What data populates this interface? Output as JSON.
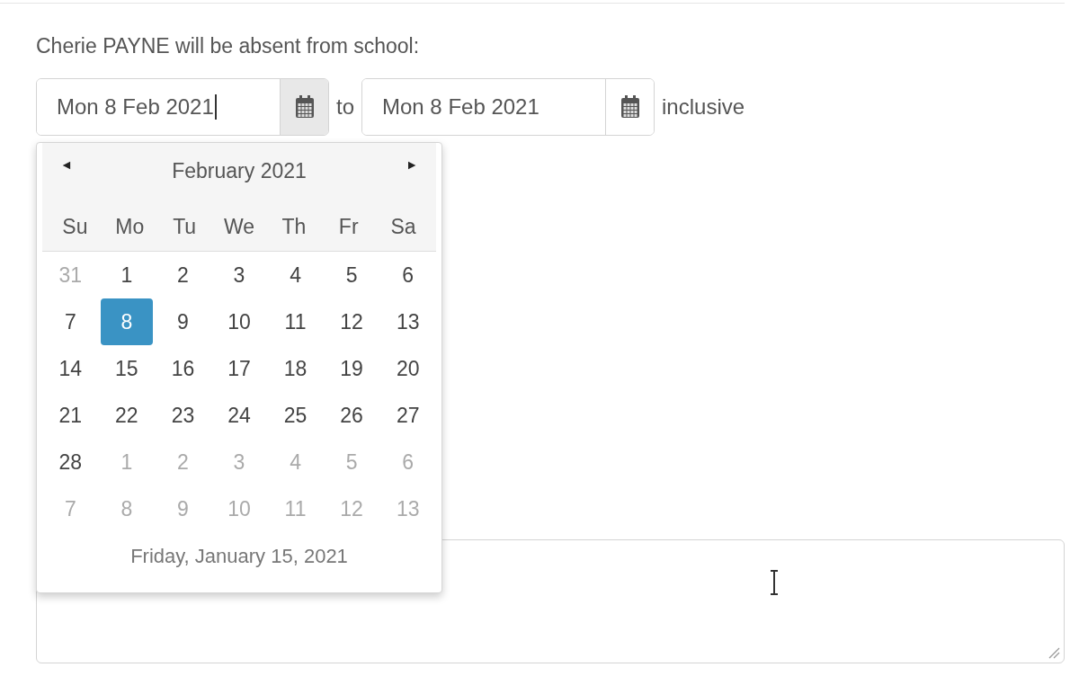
{
  "intro": "Cherie PAYNE will be absent from school:",
  "date_from": {
    "value": "Mon 8 Feb 2021",
    "focused": true,
    "picker_open": true
  },
  "separator": "to",
  "date_to": {
    "value": "Mon 8 Feb 2021",
    "focused": false,
    "picker_open": false
  },
  "suffix": "inclusive",
  "calendar": {
    "prev": "◄",
    "title": "February 2021",
    "next": "►",
    "weekdays": [
      "Su",
      "Mo",
      "Tu",
      "We",
      "Th",
      "Fr",
      "Sa"
    ],
    "days": [
      {
        "label": "31",
        "muted": true,
        "selected": false
      },
      {
        "label": "1",
        "muted": false,
        "selected": false
      },
      {
        "label": "2",
        "muted": false,
        "selected": false
      },
      {
        "label": "3",
        "muted": false,
        "selected": false
      },
      {
        "label": "4",
        "muted": false,
        "selected": false
      },
      {
        "label": "5",
        "muted": false,
        "selected": false
      },
      {
        "label": "6",
        "muted": false,
        "selected": false
      },
      {
        "label": "7",
        "muted": false,
        "selected": false
      },
      {
        "label": "8",
        "muted": false,
        "selected": true
      },
      {
        "label": "9",
        "muted": false,
        "selected": false
      },
      {
        "label": "10",
        "muted": false,
        "selected": false
      },
      {
        "label": "11",
        "muted": false,
        "selected": false
      },
      {
        "label": "12",
        "muted": false,
        "selected": false
      },
      {
        "label": "13",
        "muted": false,
        "selected": false
      },
      {
        "label": "14",
        "muted": false,
        "selected": false
      },
      {
        "label": "15",
        "muted": false,
        "selected": false
      },
      {
        "label": "16",
        "muted": false,
        "selected": false
      },
      {
        "label": "17",
        "muted": false,
        "selected": false
      },
      {
        "label": "18",
        "muted": false,
        "selected": false
      },
      {
        "label": "19",
        "muted": false,
        "selected": false
      },
      {
        "label": "20",
        "muted": false,
        "selected": false
      },
      {
        "label": "21",
        "muted": false,
        "selected": false
      },
      {
        "label": "22",
        "muted": false,
        "selected": false
      },
      {
        "label": "23",
        "muted": false,
        "selected": false
      },
      {
        "label": "24",
        "muted": false,
        "selected": false
      },
      {
        "label": "25",
        "muted": false,
        "selected": false
      },
      {
        "label": "26",
        "muted": false,
        "selected": false
      },
      {
        "label": "27",
        "muted": false,
        "selected": false
      },
      {
        "label": "28",
        "muted": false,
        "selected": false
      },
      {
        "label": "1",
        "muted": true,
        "selected": false
      },
      {
        "label": "2",
        "muted": true,
        "selected": false
      },
      {
        "label": "3",
        "muted": true,
        "selected": false
      },
      {
        "label": "4",
        "muted": true,
        "selected": false
      },
      {
        "label": "5",
        "muted": true,
        "selected": false
      },
      {
        "label": "6",
        "muted": true,
        "selected": false
      },
      {
        "label": "7",
        "muted": true,
        "selected": false
      },
      {
        "label": "8",
        "muted": true,
        "selected": false
      },
      {
        "label": "9",
        "muted": true,
        "selected": false
      },
      {
        "label": "10",
        "muted": true,
        "selected": false
      },
      {
        "label": "11",
        "muted": true,
        "selected": false
      },
      {
        "label": "12",
        "muted": true,
        "selected": false
      },
      {
        "label": "13",
        "muted": true,
        "selected": false
      }
    ],
    "today": "Friday, January 15, 2021"
  },
  "notes": {
    "kind": "textarea"
  }
}
